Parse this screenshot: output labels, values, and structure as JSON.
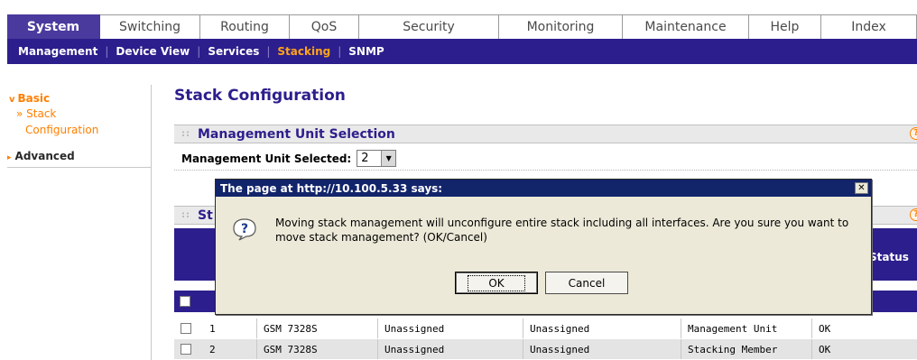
{
  "top_tabs": [
    {
      "label": "System",
      "active": true
    },
    {
      "label": "Switching",
      "active": false
    },
    {
      "label": "Routing",
      "active": false
    },
    {
      "label": "QoS",
      "active": false
    },
    {
      "label": "Security",
      "active": false
    },
    {
      "label": "Monitoring",
      "active": false
    },
    {
      "label": "Maintenance",
      "active": false
    },
    {
      "label": "Help",
      "active": false
    },
    {
      "label": "Index",
      "active": false
    }
  ],
  "sub_nav": [
    {
      "label": "Management",
      "active": false
    },
    {
      "label": "Device View",
      "active": false
    },
    {
      "label": "Services",
      "active": false
    },
    {
      "label": "Stacking",
      "active": true
    },
    {
      "label": "SNMP",
      "active": false
    }
  ],
  "left_nav": {
    "basic": "Basic",
    "stack_line1": "» Stack",
    "stack_line2": "Configuration",
    "advanced": "Advanced"
  },
  "page_title": "Stack Configuration",
  "management_unit_section": {
    "title": "Management Unit Selection",
    "label": "Management Unit Selected:",
    "selected_value": "2"
  },
  "stack_section": {
    "title_visible": "St",
    "status_header": "Status"
  },
  "table_rows": [
    {
      "unit": "1",
      "model": "GSM 7328S",
      "col3": "Unassigned",
      "col4": "Unassigned",
      "role": "Management Unit",
      "status": "OK"
    },
    {
      "unit": "2",
      "model": "GSM 7328S",
      "col3": "Unassigned",
      "col4": "Unassigned",
      "role": "Stacking Member",
      "status": "OK"
    }
  ],
  "dialog": {
    "title": "The page at http://10.100.5.33 says:",
    "message": "Moving stack management will unconfigure entire stack including all interfaces. Are you sure you want to move stack management? (OK/Cancel)",
    "ok_label": "OK",
    "cancel_label": "Cancel",
    "close_glyph": "✕"
  },
  "colors": {
    "brand_purple": "#2c1e8c",
    "active_tab": "#4a3a9e",
    "accent_orange": "#ff7f00",
    "dialog_title_bar": "#12246a"
  }
}
